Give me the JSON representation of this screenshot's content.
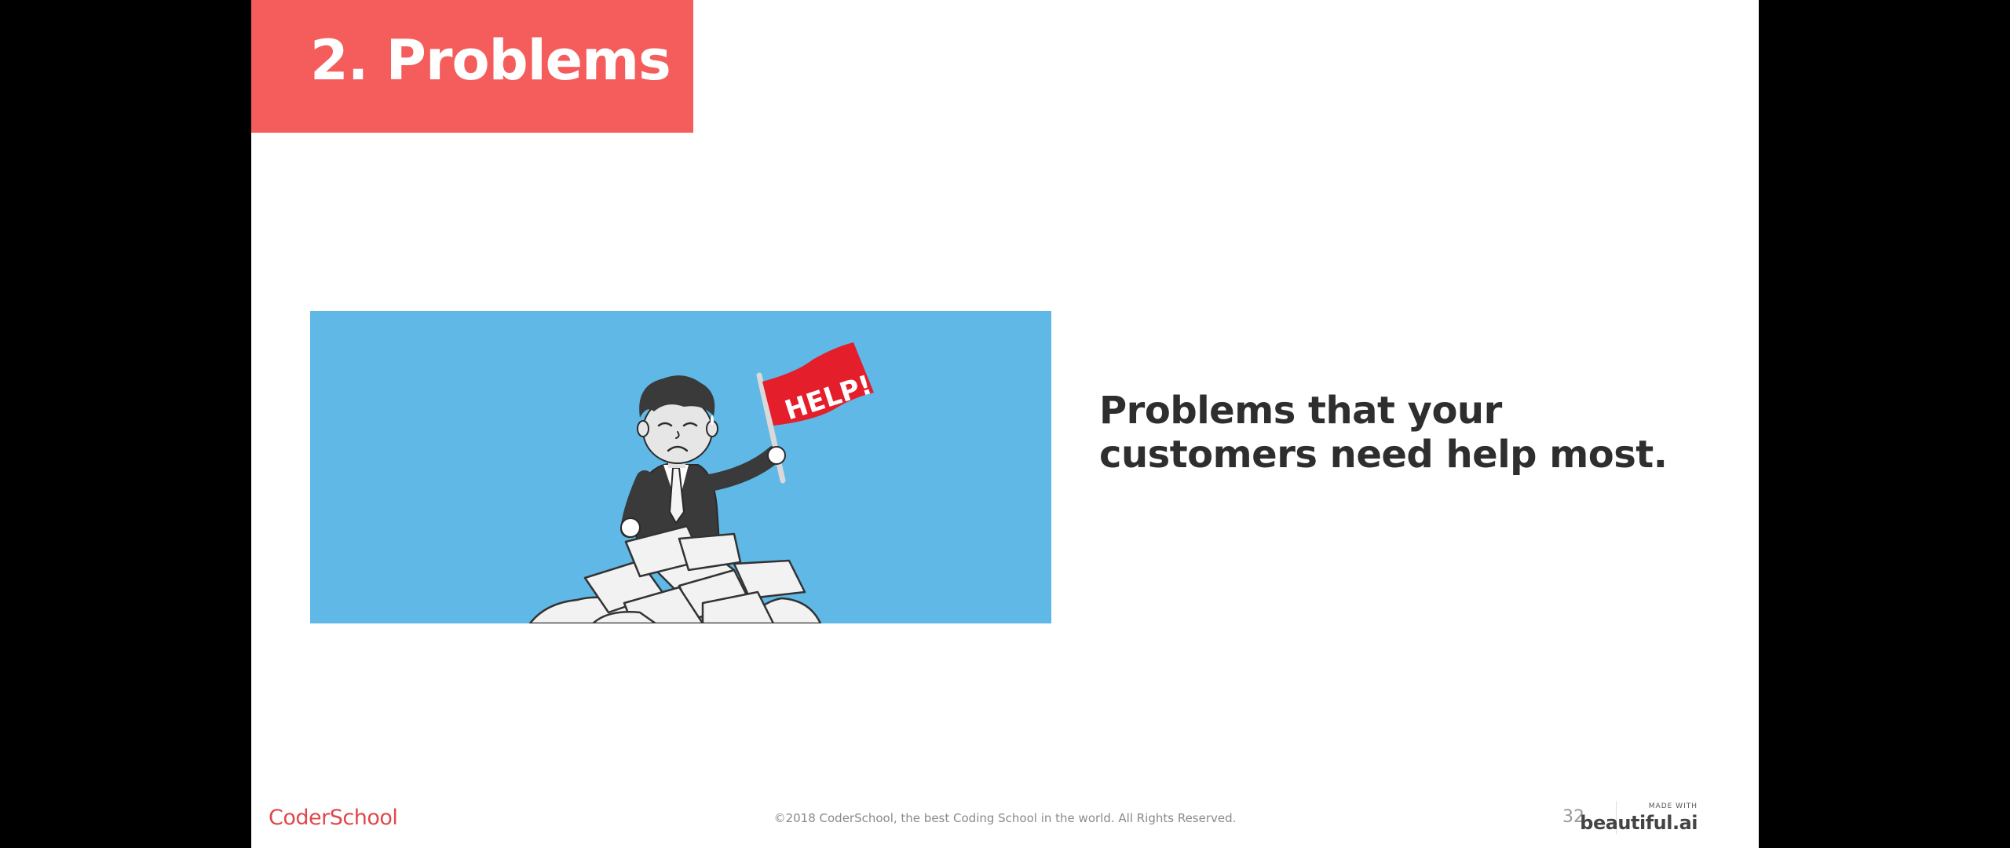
{
  "slide": {
    "title": "2. Problems",
    "body": "Problems that your customers need help most.",
    "illustration": {
      "flag_text": "HELP!"
    },
    "footer": {
      "logo_text": "CoderSchool",
      "copyright": "©2018 CoderSchool, the best Coding School in the world. All Rights Reserved.",
      "page_number": "32",
      "made_with_label": "MADE WITH",
      "made_with_brand": "beautiful.ai"
    }
  },
  "colors": {
    "title_block": "#f55d5d",
    "illustration_background": "#5fb8e6",
    "flag": "#e41e2b",
    "logo": "#e0474c"
  },
  "icons": {
    "illustration": "stressed-businessman-with-help-flag",
    "flag": "help-flag-icon"
  }
}
